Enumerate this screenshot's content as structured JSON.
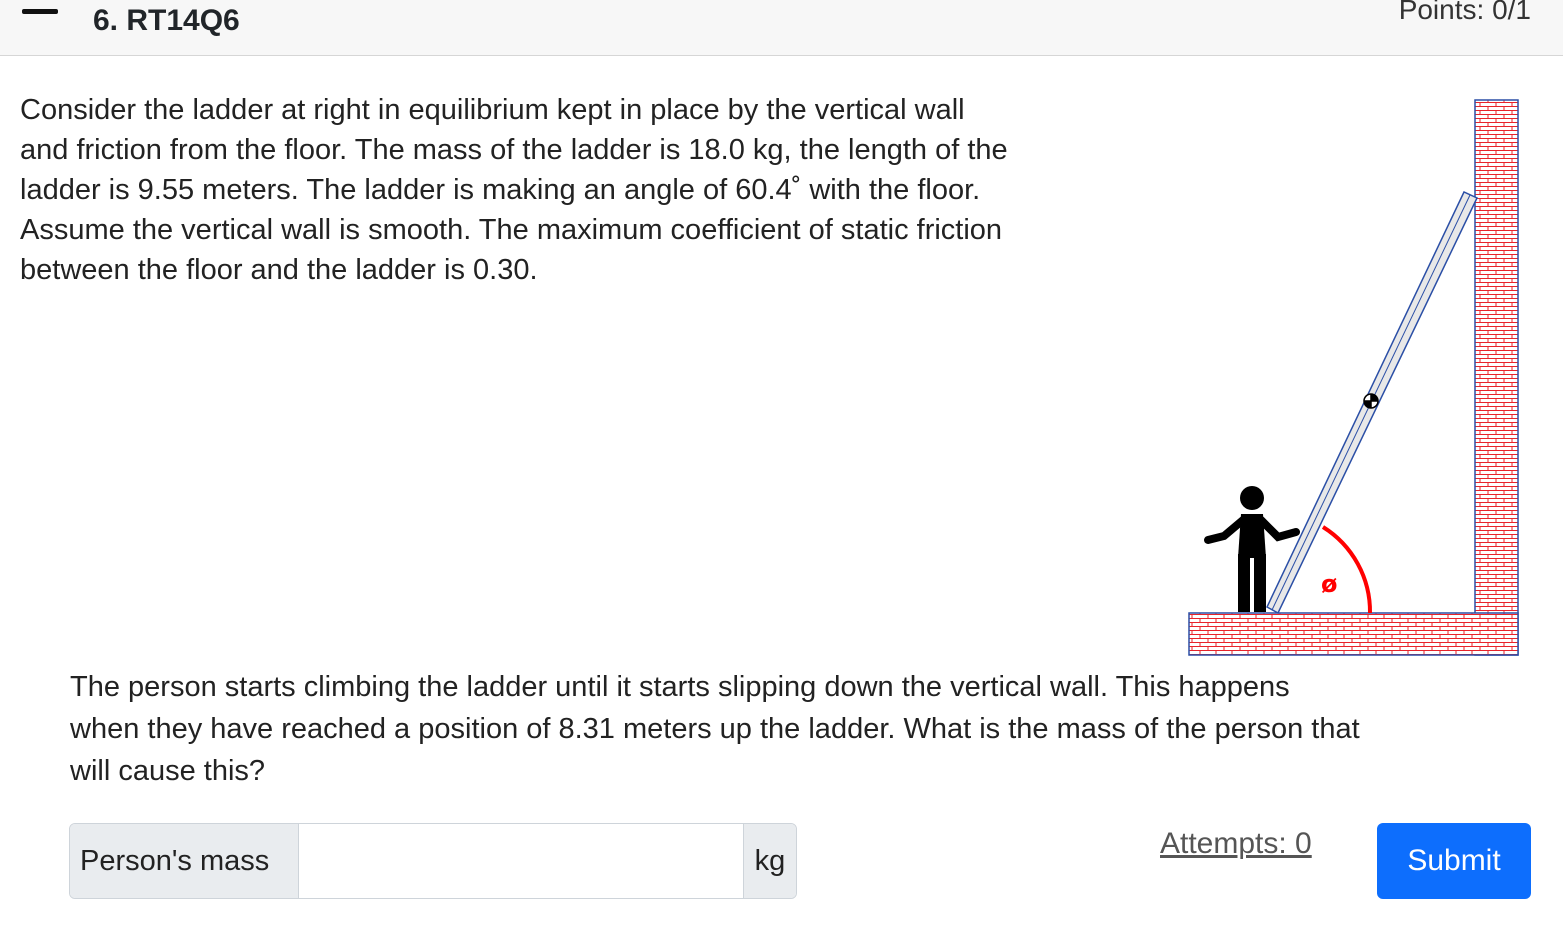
{
  "header": {
    "title": "6. RT14Q6",
    "points": "Points: 0/1",
    "collapse_icon": "minus-icon"
  },
  "problem": {
    "intro_lines": [
      "Consider the ladder at right in equilibrium kept in place by the vertical wall",
      "and friction from the floor. The mass of the ladder is 18.0 kg, the length of the",
      "ladder is 9.55 meters. The ladder is making an angle of 60.4˚ with the floor.",
      "Assume the vertical wall is smooth. The maximum coefficient of static friction",
      "between the floor and the ladder is 0.30."
    ],
    "question_lines": [
      "The person starts climbing the ladder until it starts slipping down the vertical wall. This happens",
      "when they have reached a position of 8.31 meters up the ladder. What is the mass of the person that",
      "will cause this?"
    ]
  },
  "figure": {
    "angle_symbol": "ø",
    "brick_color": "#e8232a",
    "angle_color": "#ff0000",
    "ladder_color": "#e8e8e8",
    "outline_color": "#2b4fa6"
  },
  "answer": {
    "label": "Person's mass",
    "value": "",
    "unit": "kg"
  },
  "footer": {
    "attempts": "Attempts: 0",
    "submit_label": "Submit",
    "submit_color": "#0d6efd"
  }
}
